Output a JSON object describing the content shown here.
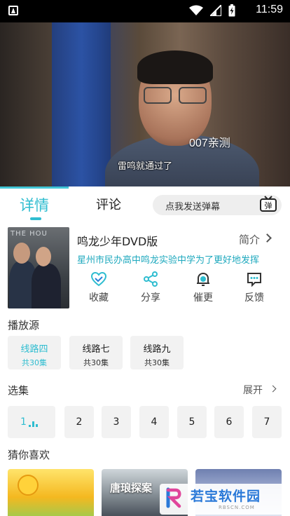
{
  "status_bar": {
    "time": "11:59",
    "icons": [
      "app-icon",
      "wifi-icon",
      "signal-icon",
      "battery-icon"
    ]
  },
  "video": {
    "watermark": "007亲测",
    "subtitle": "雷鸣就通过了"
  },
  "tabs": [
    {
      "label": "详情",
      "active": true
    },
    {
      "label": "评论",
      "active": false
    }
  ],
  "danmaku": {
    "placeholder": "点我发送弹幕",
    "button_glyph": "弹"
  },
  "show": {
    "poster_text": "THE HOU",
    "title": "鸣龙少年DVD版",
    "intro_label": "简介",
    "description": "星州市民办高中鸣龙实验中学为了更好地发挥"
  },
  "actions": [
    {
      "label": "收藏",
      "icon": "heart-icon"
    },
    {
      "label": "分享",
      "icon": "share-icon"
    },
    {
      "label": "催更",
      "icon": "bell-icon"
    },
    {
      "label": "反馈",
      "icon": "feedback-icon"
    }
  ],
  "sources_section": {
    "title": "播放源",
    "items": [
      {
        "name": "线路四",
        "count": "共30集",
        "active": true
      },
      {
        "name": "线路七",
        "count": "共30集",
        "active": false
      },
      {
        "name": "线路九",
        "count": "共30集",
        "active": false
      }
    ]
  },
  "episodes_section": {
    "title": "选集",
    "expand_label": "展开",
    "items": [
      "1",
      "2",
      "3",
      "4",
      "5",
      "6",
      "7"
    ],
    "active_index": 0
  },
  "recommend_section": {
    "title": "猜你喜欢",
    "items": [
      {
        "text": ""
      },
      {
        "text": "唐琅探案"
      },
      {
        "text": ""
      }
    ]
  },
  "brand": {
    "name": "若宝软件园",
    "sub": "RBSCN.COM"
  },
  "colors": {
    "accent": "#2fbdd0",
    "chip_bg": "#f2f2f2"
  }
}
